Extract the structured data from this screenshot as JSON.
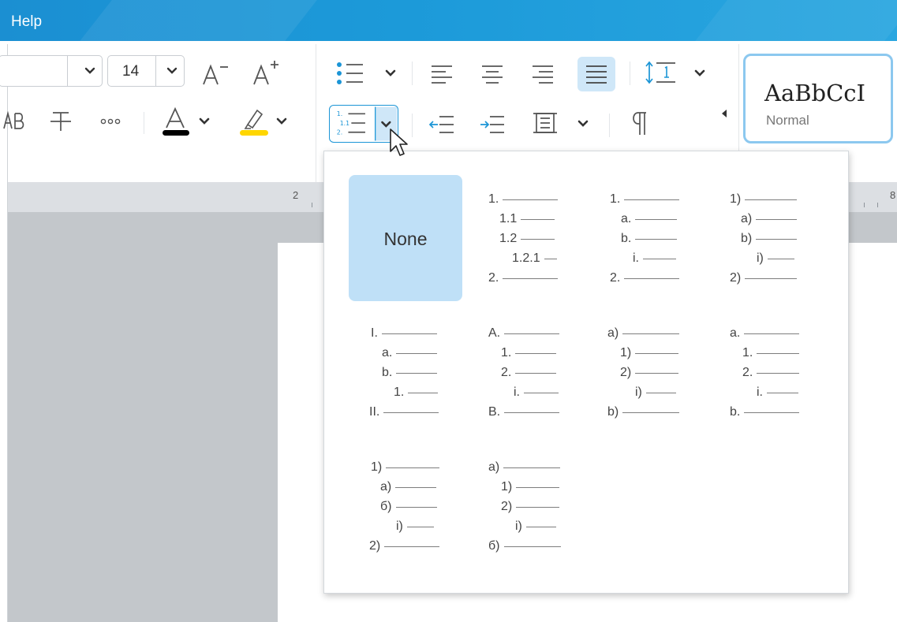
{
  "menu": {
    "help_label": "Help"
  },
  "toolbar": {
    "font_size": "14",
    "style_sample": "AaBbCcI",
    "style_name": "Normal",
    "more_label": "•••",
    "strike_glyph": "ᴬB",
    "font_color": "#000000",
    "highlight_color": "#ffd600",
    "accent_color": "#1b95d6"
  },
  "ruler": {
    "labels": [
      "2",
      "8"
    ]
  },
  "numbering_popup": {
    "none_label": "None",
    "rows": [
      [
        {
          "type": "none"
        },
        {
          "lines": [
            "1.",
            "1.1",
            "1.2",
            "1.2.1",
            "2."
          ]
        },
        {
          "lines": [
            "1.",
            "a.",
            "b.",
            "i.",
            "2."
          ]
        },
        {
          "lines": [
            "1)",
            "a)",
            "b)",
            "i)",
            "2)"
          ]
        }
      ],
      [
        {
          "lines": [
            "I.",
            "a.",
            "b.",
            "1.",
            "II."
          ]
        },
        {
          "lines": [
            "A.",
            "1.",
            "2.",
            "i.",
            "B."
          ]
        },
        {
          "lines": [
            "a)",
            "1)",
            "2)",
            "i)",
            "b)"
          ]
        },
        {
          "lines": [
            "a.",
            "1.",
            "2.",
            "i.",
            "b."
          ]
        }
      ],
      [
        {
          "lines": [
            "1)",
            "a)",
            "б)",
            "i)",
            "2)"
          ]
        },
        {
          "lines": [
            "a)",
            "1)",
            "2)",
            "i)",
            "б)"
          ]
        }
      ]
    ]
  }
}
